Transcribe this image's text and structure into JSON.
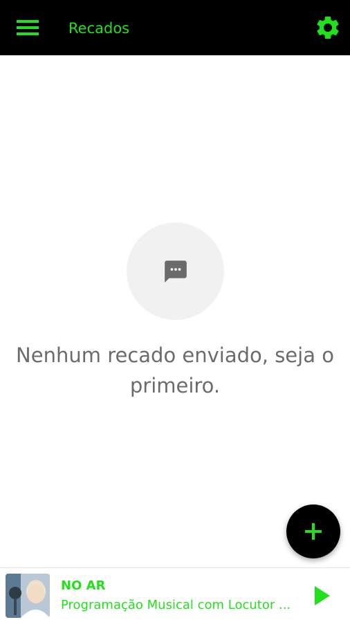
{
  "colors": {
    "accent": "#22e01b",
    "topbar_bg": "#000000",
    "empty_text": "#6b6b6b",
    "empty_circle": "#f1f1f1",
    "fab_bg": "#000000"
  },
  "header": {
    "menu_icon": "hamburger-menu-icon",
    "title": "Recados",
    "settings_icon": "gear-icon"
  },
  "empty_state": {
    "icon": "chat-bubble-icon",
    "message": "Nenhum recado enviado, seja o primeiro."
  },
  "fab": {
    "icon": "plus-icon"
  },
  "player": {
    "cover_icon": "host-photo",
    "label": "NO AR",
    "track": "Programação Musical com Locutor ...",
    "play_icon": "play-icon"
  }
}
